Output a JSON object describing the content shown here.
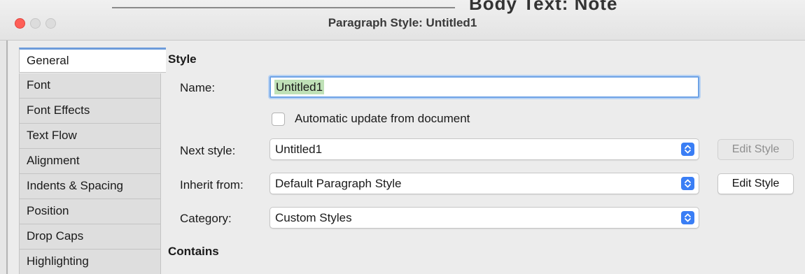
{
  "window": {
    "title": "Paragraph Style: Untitled1",
    "background_text": "Body Text: Note"
  },
  "tabs": [
    {
      "label": "General",
      "active": true
    },
    {
      "label": "Font"
    },
    {
      "label": "Font Effects"
    },
    {
      "label": "Text Flow"
    },
    {
      "label": "Alignment"
    },
    {
      "label": "Indents & Spacing"
    },
    {
      "label": "Position"
    },
    {
      "label": "Drop Caps"
    },
    {
      "label": "Highlighting"
    }
  ],
  "style_section": {
    "heading": "Style",
    "name_label": "Name:",
    "name_value": "Untitled1",
    "auto_update_label": "Automatic update from document",
    "auto_update_checked": false,
    "next_style_label": "Next style:",
    "next_style_value": "Untitled1",
    "next_style_edit": "Edit Style",
    "inherit_label": "Inherit from:",
    "inherit_value": "Default Paragraph Style",
    "inherit_edit": "Edit Style",
    "category_label": "Category:",
    "category_value": "Custom Styles"
  },
  "contains_section": {
    "heading": "Contains"
  },
  "colors": {
    "close_button": "#fe5f57",
    "accent_blue": "#3a7ef5",
    "focus_ring": "#6ea3e6",
    "text_selection": "#bfe1b7"
  }
}
